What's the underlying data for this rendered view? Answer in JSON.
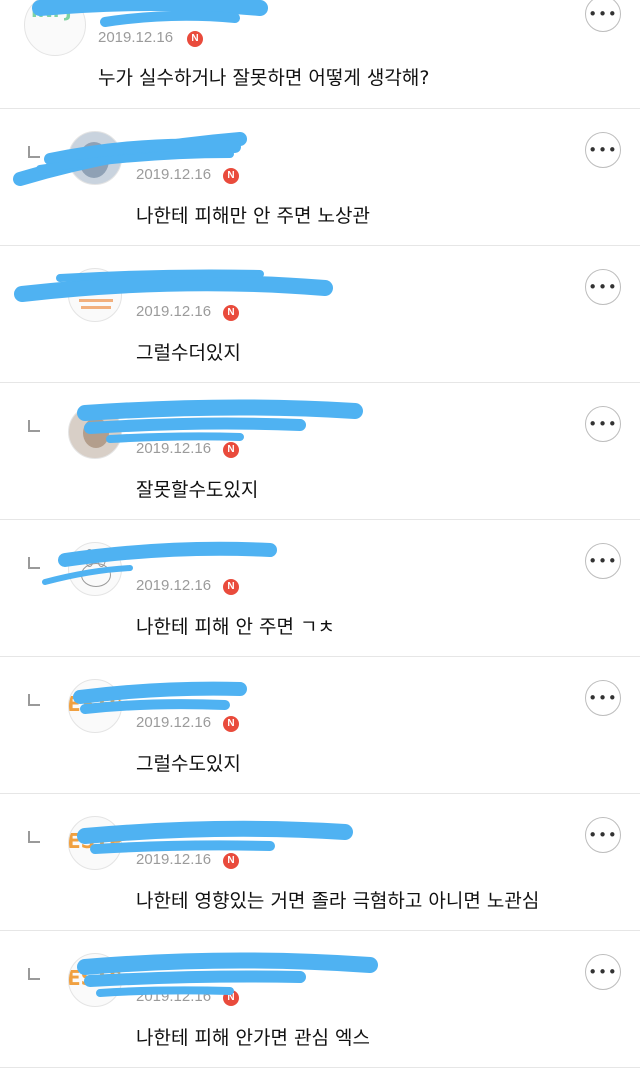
{
  "colors": {
    "scribble": "#4fb2f2",
    "badge": "#e94b3c",
    "date": "#9b9b9b",
    "divider": "#e6e6e6"
  },
  "icons": {
    "more": "more-horizontal-icon",
    "reply": "reply-arrow-icon",
    "badge": "new-badge-icon"
  },
  "comments": [
    {
      "date": "2019.12.16",
      "badge": "N",
      "text": "누가 실수하거나 잘못하면 어떻게 생각해?",
      "more": "•••",
      "avatar_text": "INFJ"
    },
    {
      "date": "2019.12.16",
      "badge": "N",
      "text": "나한테 피해만 안 주면 노상관",
      "more": "•••"
    },
    {
      "date": "2019.12.16",
      "badge": "N",
      "text": "그럴수더있지",
      "more": "•••"
    },
    {
      "date": "2019.12.16",
      "badge": "N",
      "text": "잘못할수도있지",
      "more": "•••"
    },
    {
      "date": "2019.12.16",
      "badge": "N",
      "text": "나한테 피해 안 주면 ㄱㅊ",
      "more": "•••"
    },
    {
      "date": "2019.12.16",
      "badge": "N",
      "text": "그럴수도있지",
      "more": "•••",
      "avatar_text": "ESTP"
    },
    {
      "date": "2019.12.16",
      "badge": "N",
      "text": "나한테 영향있는 거면 졸라 극혐하고 아니면 노관심",
      "more": "•••",
      "avatar_text": "ESTP"
    },
    {
      "date": "2019.12.16",
      "badge": "N",
      "text": "나한테 피해 안가면 관심 엑스",
      "more": "•••",
      "avatar_text": "ESTP"
    }
  ]
}
